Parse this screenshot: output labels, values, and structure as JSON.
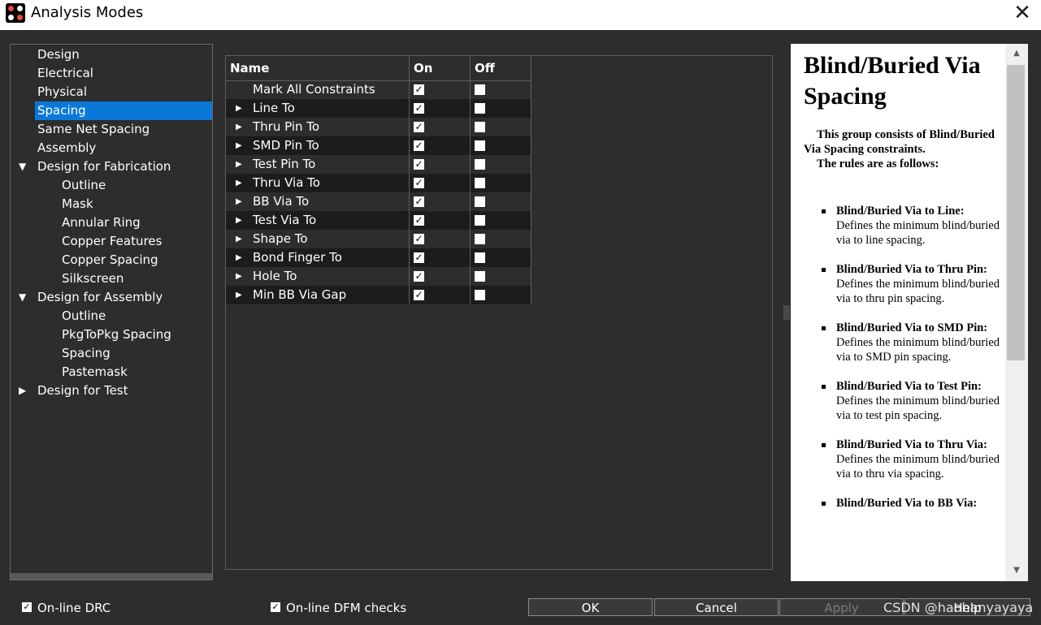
{
  "window": {
    "title": "Analysis Modes",
    "close_label": "✕"
  },
  "tree": {
    "items": [
      {
        "label": "Design",
        "selected": false
      },
      {
        "label": "Electrical",
        "selected": false
      },
      {
        "label": "Physical",
        "selected": false
      },
      {
        "label": "Spacing",
        "selected": true
      },
      {
        "label": "Same Net Spacing",
        "selected": false
      },
      {
        "label": "Assembly",
        "selected": false
      },
      {
        "label": "Design for Fabrication",
        "selected": false,
        "expander": "expanded"
      },
      {
        "label": "Outline",
        "selected": false
      },
      {
        "label": "Mask",
        "selected": false
      },
      {
        "label": "Annular Ring",
        "selected": false
      },
      {
        "label": "Copper Features",
        "selected": false
      },
      {
        "label": "Copper Spacing",
        "selected": false
      },
      {
        "label": "Silkscreen",
        "selected": false
      },
      {
        "label": "Design for Assembly",
        "selected": false,
        "expander": "expanded"
      },
      {
        "label": "Outline",
        "selected": false
      },
      {
        "label": "PkgToPkg Spacing",
        "selected": false
      },
      {
        "label": "Spacing",
        "selected": false
      },
      {
        "label": "Pastemask",
        "selected": false
      },
      {
        "label": "Design for Test",
        "selected": false,
        "expander": "collapsed"
      }
    ]
  },
  "grid": {
    "columns": [
      "Name",
      "On",
      "Off"
    ],
    "rows": [
      {
        "name": "Mark All Constraints",
        "expandable": false,
        "on": true,
        "off": false
      },
      {
        "name": "Line To",
        "expandable": true,
        "on": true,
        "off": false
      },
      {
        "name": "Thru Pin To",
        "expandable": true,
        "on": true,
        "off": false
      },
      {
        "name": "SMD Pin To",
        "expandable": true,
        "on": true,
        "off": false
      },
      {
        "name": "Test Pin To",
        "expandable": true,
        "on": true,
        "off": false
      },
      {
        "name": "Thru Via To",
        "expandable": true,
        "on": true,
        "off": false
      },
      {
        "name": "BB Via To",
        "expandable": true,
        "on": true,
        "off": false
      },
      {
        "name": "Test Via To",
        "expandable": true,
        "on": true,
        "off": false
      },
      {
        "name": "Shape To",
        "expandable": true,
        "on": true,
        "off": false
      },
      {
        "name": "Bond Finger To",
        "expandable": true,
        "on": true,
        "off": false
      },
      {
        "name": "Hole To",
        "expandable": true,
        "on": true,
        "off": false
      },
      {
        "name": "Min BB Via Gap",
        "expandable": true,
        "on": true,
        "off": false
      }
    ]
  },
  "help": {
    "title": "Blind/Buried Via Spacing",
    "intro_line1": "This group consists of Blind/Buried Via Spacing constraints.",
    "intro_line2": "The rules are as follows:",
    "rules": [
      {
        "term": "Blind/Buried Via to Line:",
        "desc": "Defines the minimum blind/buried via to line spacing."
      },
      {
        "term": "Blind/Buried Via to Thru Pin:",
        "desc": "Defines the minimum blind/buried via to thru pin spacing."
      },
      {
        "term": "Blind/Buried Via to SMD Pin:",
        "desc": "Defines the minimum blind/buried via to SMD pin spacing."
      },
      {
        "term": "Blind/Buried Via to Test Pin:",
        "desc": "Defines the minimum blind/buried via to test pin spacing."
      },
      {
        "term": "Blind/Buried Via to Thru Via:",
        "desc": "Defines the minimum blind/buried via to thru via spacing."
      },
      {
        "term": "Blind/Buried Via to BB Via:",
        "desc": ""
      }
    ]
  },
  "footer": {
    "online_drc": {
      "label": "On-line DRC",
      "checked": true
    },
    "online_dfm": {
      "label": "On-line DFM checks",
      "checked": true
    },
    "ok_label": "OK",
    "cancel_label": "Cancel",
    "apply_label": "Apply",
    "help_label": "Help",
    "watermark": "CSDN @haohanyayaya"
  },
  "colors": {
    "background": "#2d2d2d",
    "selection": "#0a78d7",
    "alt_row": "#1c1c1c"
  }
}
